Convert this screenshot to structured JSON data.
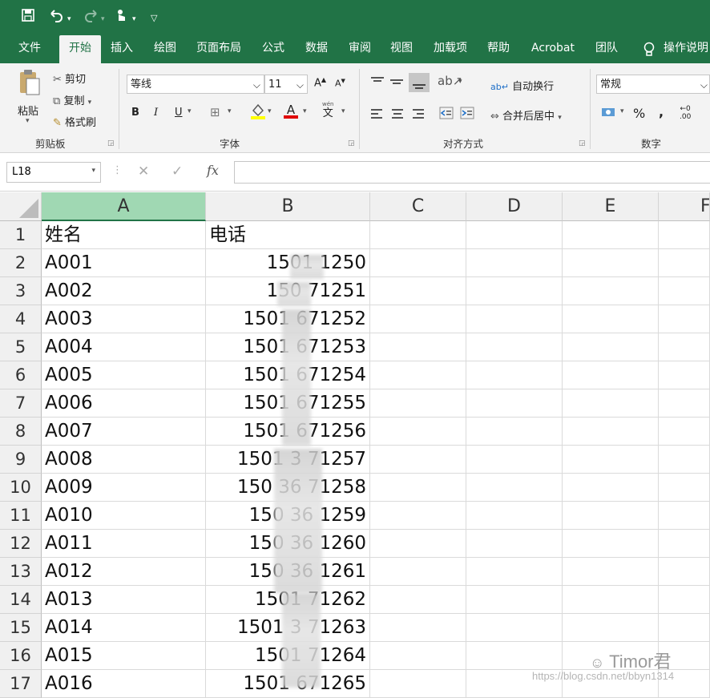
{
  "quick_access": {
    "save_icon": "save-icon",
    "undo_icon": "undo-icon",
    "redo_icon": "redo-icon",
    "touch_icon": "touch-mode-icon",
    "customize_icon": "customize-qat-icon"
  },
  "tabs": [
    "文件",
    "开始",
    "插入",
    "绘图",
    "页面布局",
    "公式",
    "数据",
    "审阅",
    "视图",
    "加载项",
    "帮助",
    "Acrobat",
    "团队"
  ],
  "active_tab": "开始",
  "tell_me": "操作说明",
  "clipboard": {
    "paste": "粘贴",
    "cut": "剪切",
    "copy": "复制",
    "format_painter": "格式刷",
    "group_label": "剪贴板"
  },
  "font": {
    "name": "等线",
    "size": "11",
    "grow": "A",
    "shrink": "A",
    "bold": "B",
    "italic": "I",
    "underline": "U",
    "font_color_letter": "A",
    "phonetic": "文",
    "phonetic_top": "wén",
    "group_label": "字体"
  },
  "alignment": {
    "wrap_text": "自动换行",
    "merge_center": "合并后居中",
    "group_label": "对齐方式"
  },
  "number": {
    "format": "常规",
    "percent": "%",
    "comma": ",",
    "group_label": "数字"
  },
  "formula_bar": {
    "name_box": "L18",
    "fx": "fx",
    "cancel": "✕",
    "enter": "✓",
    "content": ""
  },
  "columns": [
    "A",
    "B",
    "C",
    "D",
    "E",
    "F"
  ],
  "rows": [
    {
      "n": "1",
      "a": "姓名",
      "b": "电话"
    },
    {
      "n": "2",
      "a": "A001",
      "b": "1501   1250"
    },
    {
      "n": "3",
      "a": "A002",
      "b": "150    71251"
    },
    {
      "n": "4",
      "a": "A003",
      "b": "1501   671252"
    },
    {
      "n": "5",
      "a": "A004",
      "b": "1501   671253"
    },
    {
      "n": "6",
      "a": "A005",
      "b": "1501   671254"
    },
    {
      "n": "7",
      "a": "A006",
      "b": "1501   671255"
    },
    {
      "n": "8",
      "a": "A007",
      "b": "1501   671256"
    },
    {
      "n": "9",
      "a": "A008",
      "b": "1501 3 71257"
    },
    {
      "n": "10",
      "a": "A009",
      "b": "150 36 71258"
    },
    {
      "n": "11",
      "a": "A010",
      "b": "150 36  1259"
    },
    {
      "n": "12",
      "a": "A011",
      "b": "150 36  1260"
    },
    {
      "n": "13",
      "a": "A012",
      "b": "150 36  1261"
    },
    {
      "n": "14",
      "a": "A013",
      "b": "1501   71262"
    },
    {
      "n": "15",
      "a": "A014",
      "b": "1501 3 71263"
    },
    {
      "n": "16",
      "a": "A015",
      "b": "1501   71264"
    },
    {
      "n": "17",
      "a": "A016",
      "b": "1501  671265"
    }
  ],
  "watermark": {
    "brand": "Timor君",
    "url": "https://blog.csdn.net/bbyn1314"
  },
  "colors": {
    "excel_green": "#217346",
    "selected_header": "#a0d8b3"
  }
}
